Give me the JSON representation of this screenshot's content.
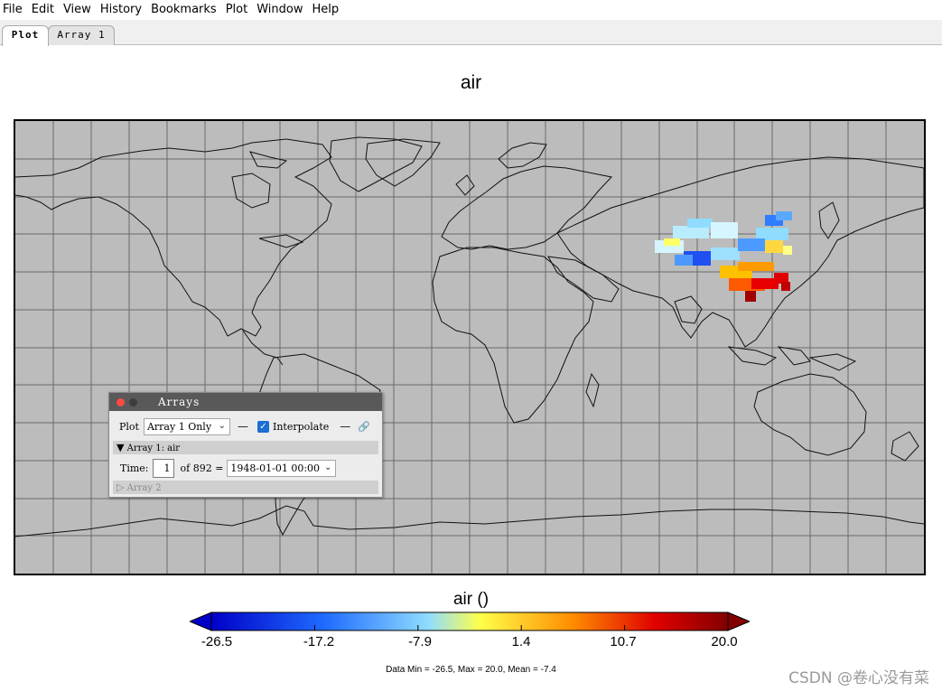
{
  "menubar": {
    "items": [
      "File",
      "Edit",
      "View",
      "History",
      "Bookmarks",
      "Plot",
      "Window",
      "Help"
    ]
  },
  "tabs": [
    {
      "label": "Plot",
      "active": true
    },
    {
      "label": "Array 1",
      "active": false
    }
  ],
  "plot": {
    "title": "air",
    "colorbar": {
      "title": "air ()",
      "ticks": [
        "-26.5",
        "-17.2",
        "-7.9",
        "1.4",
        "10.7",
        "20.0"
      ],
      "colors": [
        "#0000c8",
        "#1f6cff",
        "#8fdcff",
        "#ffff4a",
        "#ff8c00",
        "#e00000",
        "#820000"
      ]
    },
    "summary": "Data Min = -26.5, Max = 20.0, Mean = -7.4",
    "map_background": "#bcbcbc"
  },
  "arrays_panel": {
    "title": "Arrays",
    "plot_label": "Plot",
    "plot_mode": "Array 1 Only",
    "interpolate_label": "Interpolate",
    "interpolate_checked": true,
    "array1_header": "Array 1: air",
    "time_label": "Time:",
    "time_index": "1",
    "time_of": "of 892 =",
    "time_value": "1948-01-01 00:00",
    "array2_header": "Array 2"
  },
  "icons": {
    "expand": "triangle-down-icon",
    "collapse": "triangle-right-icon",
    "link": "link-icon"
  },
  "watermark": "CSDN @卷心没有菜"
}
